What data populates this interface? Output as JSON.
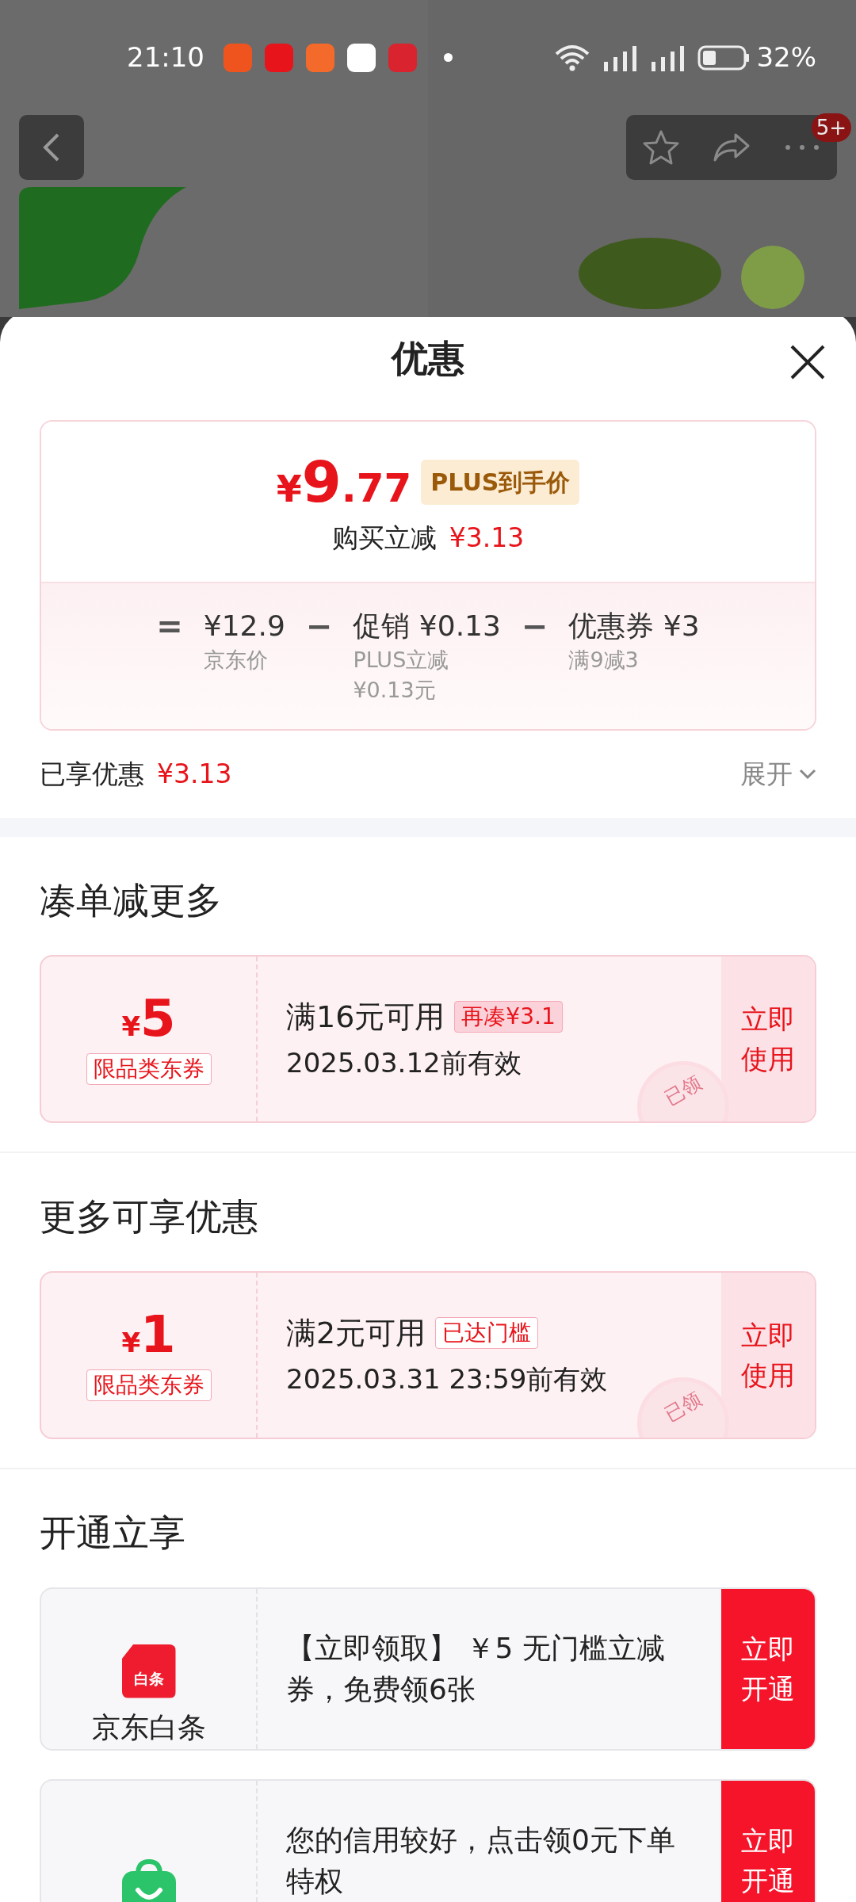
{
  "status_bar": {
    "time": "21:10",
    "battery": "32%"
  },
  "header": {
    "badge": "5+"
  },
  "sheet": {
    "title": "优惠"
  },
  "price_card": {
    "price_symbol": "¥",
    "price_int": "9",
    "price_dec": ".77",
    "price_tag": "PLUS到手价",
    "discount_label": "购买立减",
    "discount_value": "¥3.13",
    "breakdown": [
      {
        "op": "=",
        "amount": "¥12.9",
        "notes": [
          "京东价"
        ]
      },
      {
        "op": "−",
        "amount": "促销 ¥0.13",
        "notes": [
          "PLUS立减",
          "¥0.13元"
        ]
      },
      {
        "op": "−",
        "amount": "优惠券 ¥3",
        "notes": [
          "满9减3"
        ]
      }
    ]
  },
  "savings": {
    "label": "已享优惠",
    "value": "¥3.13",
    "toggle": "展开"
  },
  "sections": [
    {
      "title": "凑单减更多",
      "cards": [
        {
          "kind": "coupon",
          "symbol": "¥",
          "amount": "5",
          "scope": "限品类东券",
          "condition": "满16元可用",
          "tag": "再凑¥3.1",
          "tag_filled": true,
          "validity": "2025.03.12前有效",
          "stamp": "已领",
          "action": "立即使用"
        }
      ]
    },
    {
      "title": "更多可享优惠",
      "cards": [
        {
          "kind": "coupon",
          "symbol": "¥",
          "amount": "1",
          "scope": "限品类东券",
          "condition": "满2元可用",
          "tag": "已达门槛",
          "tag_filled": false,
          "validity": "2025.03.31 23:59前有效",
          "stamp": "已领",
          "action": "立即使用"
        }
      ]
    },
    {
      "title": "开通立享",
      "cards": [
        {
          "kind": "service",
          "logo_text": "白条",
          "name": "京东白条",
          "text": "【立即领取】 ￥5 无门槛立减券，免费领6张",
          "action": "立即开通"
        },
        {
          "kind": "service",
          "text": "您的信用较好，点击领0元下单特权",
          "action": "立即开通"
        }
      ]
    }
  ]
}
